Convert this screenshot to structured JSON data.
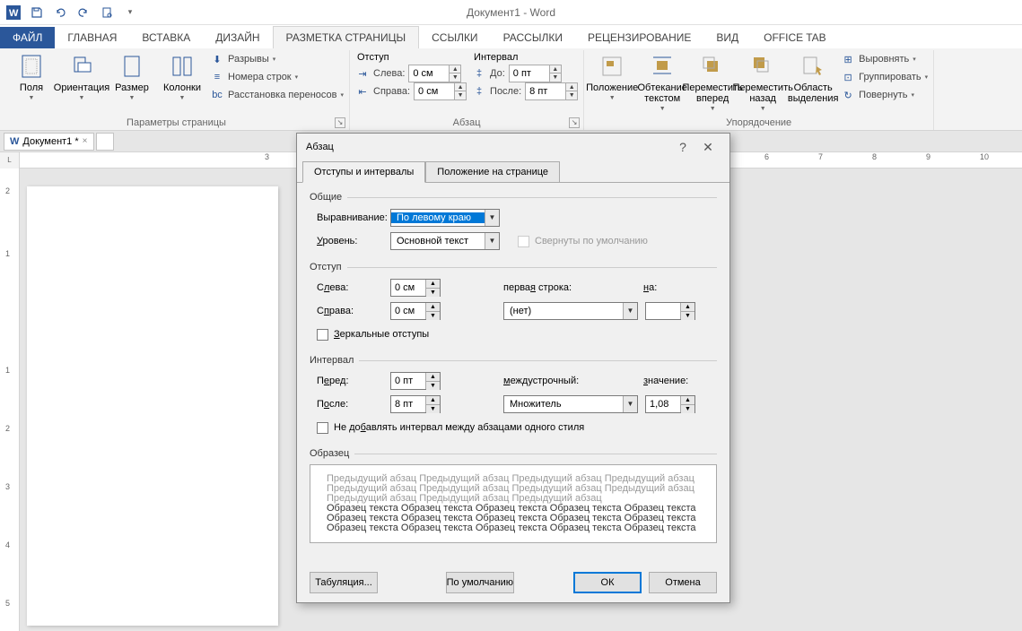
{
  "app": {
    "title": "Документ1 - Word"
  },
  "tabs": {
    "file": "ФАЙЛ",
    "home": "ГЛАВНАЯ",
    "insert": "ВСТАВКА",
    "design": "ДИЗАЙН",
    "layout": "РАЗМЕТКА СТРАНИЦЫ",
    "references": "ССЫЛКИ",
    "mailings": "РАССЫЛКИ",
    "review": "РЕЦЕНЗИРОВАНИЕ",
    "view": "ВИД",
    "officetab": "OFFICE TAB"
  },
  "ribbon": {
    "page_setup": {
      "margins": "Поля",
      "orientation": "Ориентация",
      "size": "Размер",
      "columns": "Колонки",
      "breaks": "Разрывы",
      "line_numbers": "Номера строк",
      "hyphenation": "Расстановка переносов",
      "group": "Параметры страницы"
    },
    "paragraph": {
      "indent_title": "Отступ",
      "spacing_title": "Интервал",
      "left": "Слева:",
      "right": "Справа:",
      "before": "До:",
      "after": "После:",
      "left_val": "0 см",
      "right_val": "0 см",
      "before_val": "0 пт",
      "after_val": "8 пт",
      "group": "Абзац"
    },
    "arrange": {
      "position": "Положение",
      "wrap": "Обтекание текстом",
      "forward": "Переместить вперед",
      "backward": "Переместить назад",
      "selection": "Область выделения",
      "align": "Выровнять",
      "group_cmd": "Группировать",
      "rotate": "Повернуть",
      "group": "Упорядочение"
    }
  },
  "doc_tab": {
    "name": "Документ1 *"
  },
  "dialog": {
    "title": "Абзац",
    "tab1": "Отступы и интервалы",
    "tab2": "Положение на странице",
    "general": {
      "title": "Общие",
      "alignment_lbl": "Выравнивание:",
      "alignment_val": "По левому краю",
      "level_lbl": "Уровень:",
      "level_val": "Основной текст",
      "collapsed": "Свернуты по умолчанию"
    },
    "indent": {
      "title": "Отступ",
      "left_lbl": "Слева:",
      "left_val": "0 см",
      "right_lbl": "Справа:",
      "right_val": "0 см",
      "first_lbl": "первая строка:",
      "first_val": "(нет)",
      "by_lbl": "на:",
      "mirror": "Зеркальные отступы"
    },
    "spacing": {
      "title": "Интервал",
      "before_lbl": "Перед:",
      "before_val": "0 пт",
      "after_lbl": "После:",
      "after_val": "8 пт",
      "line_lbl": "междустрочный:",
      "line_val": "Множитель",
      "at_lbl": "значение:",
      "at_val": "1,08",
      "nosame": "Не добавлять интервал между абзацами одного стиля"
    },
    "preview": {
      "title": "Образец",
      "prev": "Предыдущий абзац Предыдущий абзац Предыдущий абзац Предыдущий абзац Предыдущий абзац Предыдущий абзац Предыдущий абзац Предыдущий абзац Предыдущий абзац Предыдущий абзац Предыдущий абзац",
      "sample": "Образец текста Образец текста Образец текста Образец текста Образец текста Образец текста Образец текста Образец текста Образец текста Образец текста Образец текста Образец текста Образец текста Образец текста Образец текста"
    },
    "buttons": {
      "tabs": "Табуляция...",
      "default": "По умолчанию",
      "ok": "ОК",
      "cancel": "Отмена"
    }
  }
}
